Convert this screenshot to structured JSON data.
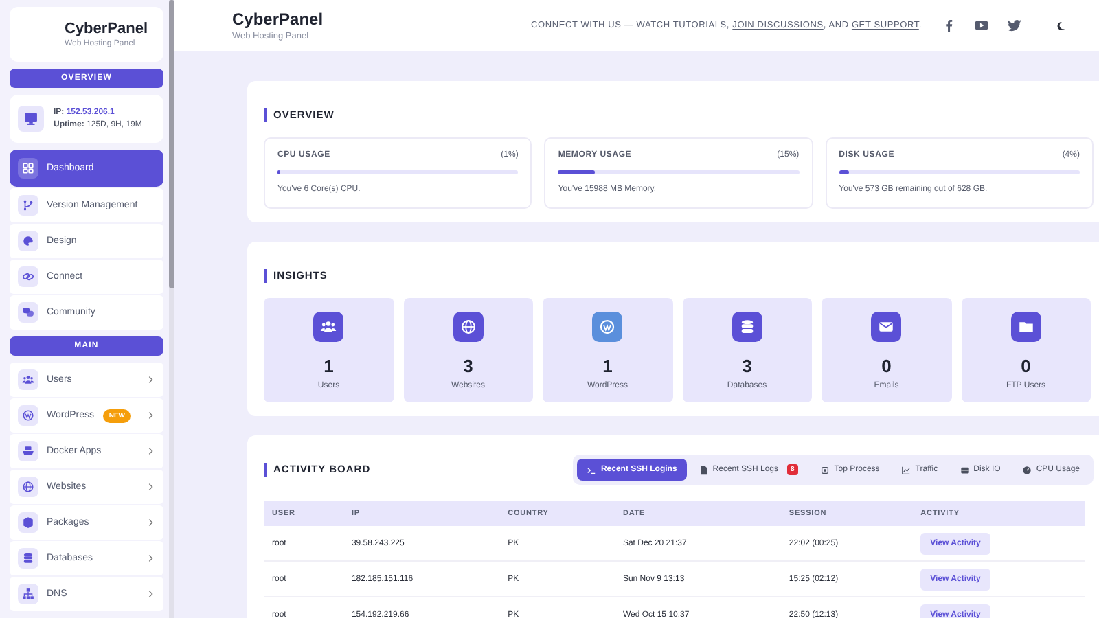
{
  "sidebar": {
    "brand": {
      "name": "CyberPanel",
      "subtitle": "Web Hosting Panel"
    },
    "overview_heading": "OVERVIEW",
    "server": {
      "ip_label": "IP:",
      "ip": "152.53.206.1",
      "uptime_label": "Uptime:",
      "uptime": "125D, 9H, 19M"
    },
    "overview_items": [
      {
        "label": "Dashboard",
        "selected": true
      },
      {
        "label": "Version Management",
        "selected": false
      },
      {
        "label": "Design",
        "selected": false
      },
      {
        "label": "Connect",
        "selected": false
      },
      {
        "label": "Community",
        "selected": false
      }
    ],
    "main_heading": "MAIN",
    "main_items": [
      {
        "label": "Users",
        "selected": false
      },
      {
        "label": "WordPress",
        "selected": false,
        "badge": "NEW"
      },
      {
        "label": "Docker Apps",
        "selected": false
      },
      {
        "label": "Websites",
        "selected": false
      },
      {
        "label": "Packages",
        "selected": false
      },
      {
        "label": "Databases",
        "selected": false
      },
      {
        "label": "DNS",
        "selected": false
      }
    ]
  },
  "header": {
    "title": "CyberPanel",
    "subtitle": "Web Hosting Panel",
    "connect": [
      {
        "kind": "text",
        "text": "CONNECT WITH US — WATCH TUTORIALS, "
      },
      {
        "kind": "link",
        "text": "JOIN DISCUSSIONS"
      },
      {
        "kind": "text",
        "text": ", AND "
      },
      {
        "kind": "link",
        "text": "GET SUPPORT"
      },
      {
        "kind": "text",
        "text": "."
      }
    ]
  },
  "overview": {
    "title": "OVERVIEW",
    "cards": [
      {
        "title": "CPU USAGE",
        "percent": "(1%)",
        "level": 0.01,
        "note": "You've 6 Core(s) CPU."
      },
      {
        "title": "MEMORY USAGE",
        "percent": "(15%)",
        "level": 0.15,
        "note": "You've 15988 MB Memory."
      },
      {
        "title": "DISK USAGE",
        "percent": "(4%)",
        "level": 0.04,
        "note": "You've 573 GB remaining out of 628 GB."
      }
    ]
  },
  "insights": {
    "title": "INSIGHTS",
    "cards": [
      {
        "count": "1",
        "label": "Users"
      },
      {
        "count": "3",
        "label": "Websites"
      },
      {
        "count": "1",
        "label": "WordPress"
      },
      {
        "count": "3",
        "label": "Databases"
      },
      {
        "count": "0",
        "label": "Emails"
      },
      {
        "count": "0",
        "label": "FTP Users"
      }
    ]
  },
  "activity": {
    "title": "ACTIVITY BOARD",
    "tabs": [
      {
        "label": "Recent SSH Logins",
        "selected": true
      },
      {
        "label": "Recent SSH Logs",
        "selected": false,
        "badge": "8"
      },
      {
        "label": "Top Process",
        "selected": false
      },
      {
        "label": "Traffic",
        "selected": false
      },
      {
        "label": "Disk IO",
        "selected": false
      },
      {
        "label": "CPU Usage",
        "selected": false
      }
    ],
    "columns": [
      "USER",
      "IP",
      "COUNTRY",
      "DATE",
      "SESSION",
      "ACTIVITY"
    ],
    "rows": [
      {
        "user": "root",
        "ip": "39.58.243.225",
        "country": "PK",
        "date": "Sat Dec 20 21:37",
        "session": "22:02 (00:25)",
        "action": "View Activity"
      },
      {
        "user": "root",
        "ip": "182.185.151.116",
        "country": "PK",
        "date": "Sun Nov 9 13:13",
        "session": "15:25 (02:12)",
        "action": "View Activity"
      },
      {
        "user": "root",
        "ip": "154.192.219.66",
        "country": "PK",
        "date": "Wed Oct 15 10:37",
        "session": "22:50 (12:13)",
        "action": "View Activity"
      }
    ]
  }
}
